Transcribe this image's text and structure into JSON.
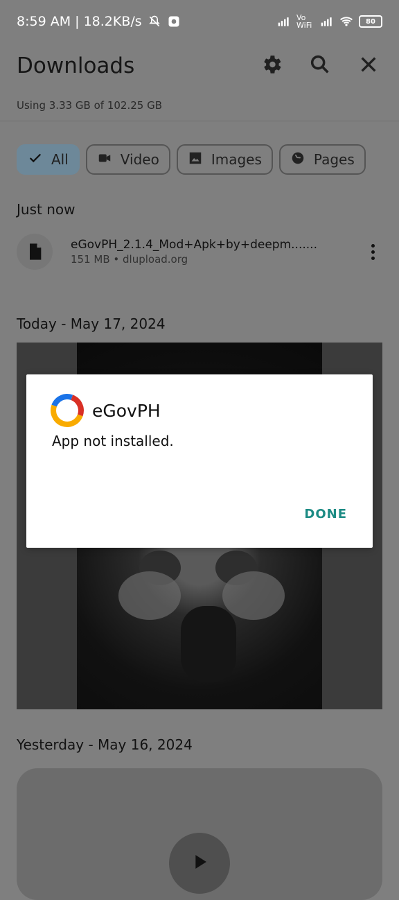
{
  "status_bar": {
    "time_speed": "8:59 AM | 18.2KB/s",
    "wifi_label": "Vo WiFi",
    "battery": "80"
  },
  "header": {
    "title": "Downloads"
  },
  "usage": "Using 3.33 GB of 102.25 GB",
  "chips": [
    {
      "label": "All",
      "icon": "check-icon"
    },
    {
      "label": "Video",
      "icon": "video-camera-icon"
    },
    {
      "label": "Images",
      "icon": "image-icon"
    },
    {
      "label": "Pages",
      "icon": "globe-icon"
    }
  ],
  "sections": {
    "just_now": "Just now",
    "today": "Today - May 17, 2024",
    "yesterday": "Yesterday - May 16, 2024"
  },
  "file": {
    "name": "eGovPH_2.1.4_Mod+Apk+by+deepm.......",
    "meta": "151 MB • dlupload.org"
  },
  "dialog": {
    "app_name": "eGovPH",
    "message": "App not installed.",
    "done": "DONE"
  }
}
